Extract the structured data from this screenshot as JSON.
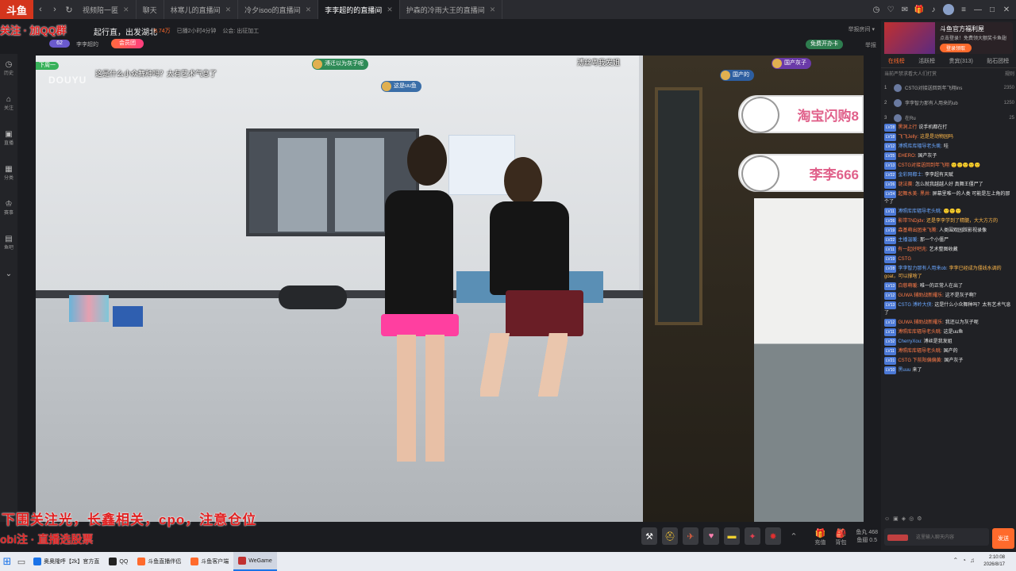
{
  "tabs": [
    {
      "label": "视频陪一匿",
      "active": false
    },
    {
      "label": "聊天",
      "active": false
    },
    {
      "label": "林寒儿的直播间",
      "active": false
    },
    {
      "label": "冷夕isoo的直播间",
      "active": false
    },
    {
      "label": "李李超的的直播间",
      "active": true
    },
    {
      "label": "护森的冷雨大王的直播间",
      "active": false
    }
  ],
  "app_logo": "斗鱼",
  "room": {
    "title": "起行直，出发湖北",
    "host_tag": "李李超的",
    "level": "62",
    "follow_label": "会员团",
    "meta": [
      "5.74万",
      "已播2小时4分钟",
      "公会: 出征加工"
    ],
    "share": "举报房间 ▾",
    "free_pill": "免费开办卡",
    "report": "举报"
  },
  "left_rail": [
    "历史",
    "关注",
    "直播",
    "分类",
    "赛事",
    "鱼吧"
  ],
  "overlay": {
    "top_text": "关注 · 加QQ群",
    "bottom_text": "下围关注光，长鑫相关，cpo，注意仓位",
    "bottom_text2": "obi注 · 直播选股票"
  },
  "video": {
    "watermark": "DOUYU",
    "progress_badge": "下周一",
    "danmu": [
      {
        "text": "这是什么小众舞种吗？太有艺术气息了",
        "color": "#ffffff"
      },
      {
        "text": "溥丝粤我发姐",
        "color": "#ffffff"
      }
    ],
    "badges": [
      {
        "text": "溥迁以为灰子呢",
        "color": "#2e8b57"
      },
      {
        "text": "这是uu鱼",
        "color": "#3a6ea8"
      },
      {
        "text": "国产的",
        "color": "#2d5ea0"
      },
      {
        "text": "国产灰子",
        "color": "#6a3aa8"
      }
    ],
    "stickers": [
      {
        "text": "淘宝闪购8"
      },
      {
        "text": "李李666"
      }
    ]
  },
  "gift_icons": [
    "hammer-icon",
    "helmet-icon",
    "rocket-icon",
    "heart-icon",
    "gold-bar-icon",
    "plane-icon",
    "fire-icon"
  ],
  "gift_right": [
    {
      "label": "充值",
      "icon": "🎁"
    },
    {
      "label": "背包",
      "icon": "🎒"
    },
    {
      "label": "鱼丸 468",
      "icon": ""
    },
    {
      "label": "鱼翅 0.5",
      "icon": ""
    }
  ],
  "side": {
    "promo": {
      "t1": "斗鱼官方福利屋",
      "t2": "点击登录！免费领大额奖卡鱼翅",
      "btn": "登录领取"
    },
    "tabs": [
      "在线榜",
      "活跃榜",
      "贵宾(313)",
      "贴石团榜"
    ],
    "rank_header": [
      "当前严禁求看大人们打赏",
      "规则"
    ],
    "rank": [
      {
        "n": "1",
        "name": "CSTG对接送回到年飞翔ins",
        "score": "2350"
      },
      {
        "n": "2",
        "name": "李李智力那有人用来的ub",
        "score": "1250"
      },
      {
        "n": "3",
        "name": "在Ru",
        "score": "25"
      }
    ],
    "chat": [
      {
        "lv": "LV28",
        "user": "黑洞上行",
        "text": "说手机都在打"
      },
      {
        "lv": "LV18",
        "user": "飞飞Jelly:",
        "text": "这是是动物园吗",
        "orange": true
      },
      {
        "lv": "LV12",
        "user": "溥照库库辐导老头眺:",
        "text": "哇"
      },
      {
        "lv": "LV25",
        "user": "EHERO:",
        "text": "国产灰子"
      },
      {
        "lv": "LV13",
        "user": "CSTG对接送回到年飞翔",
        "text": "🙂🙂🙂🙂🙂"
      },
      {
        "lv": "LV22",
        "user": "金彩网都士:",
        "text": "李李超有天赋"
      },
      {
        "lv": "LV26",
        "user": "谜法赛:",
        "text": "怎么就我越越人好 真舞王僵尸了"
      },
      {
        "lv": "LV24",
        "user": "起舞水美· 黑井:",
        "text": "屏幕里唯一的人类 可能是左上角的那个了"
      },
      {
        "lv": "LV11",
        "user": "溥照库库辐导老头眺:",
        "text": "🙂🙂🙂"
      },
      {
        "lv": "LV26",
        "user": "影带TNDjdv:",
        "text": "还是李李学到了精髓，大大方方的",
        "orange": true
      },
      {
        "lv": "LV19",
        "user": "森基萌出团来飞腾:",
        "text": "人类围观园踩影视录像"
      },
      {
        "lv": "LV22",
        "user": "主播温暖:",
        "text": "那一个小僵尸"
      },
      {
        "lv": "LV11",
        "user": "有一起好吧兆:",
        "text": "艺术整图收藏"
      },
      {
        "lv": "LV19",
        "user": "CSTG",
        "text": ""
      },
      {
        "lv": "LV28",
        "user": "李李智力那有人用来ob:",
        "text": "李李已经成为僵线水调的goat，可以撑啥了",
        "orange": true
      },
      {
        "lv": "LV13",
        "user": "白慈萌暖:",
        "text": "唯一的正常人在出了"
      },
      {
        "lv": "LV12",
        "user": "GUWA 辅助战新耀乐:",
        "text": "这不是灰子啊？"
      },
      {
        "lv": "LV13",
        "user": "CSTG 溥岭大侠:",
        "text": "这是什么小众舞种吗？太有艺术气息了"
      },
      {
        "lv": "LV12",
        "user": "GUWA 辅助战新耀乐:",
        "text": "我还以为灰子呢"
      },
      {
        "lv": "LV11",
        "user": "溥照库库辐导老头眺:",
        "text": "这是uu鱼"
      },
      {
        "lv": "LV32",
        "user": "CherryXou:",
        "text": "溥丝是我发姐"
      },
      {
        "lv": "LV11",
        "user": "溥照库库辐导老头眺:",
        "text": "国产的"
      },
      {
        "lv": "LV21",
        "user": "CSTG 下前阳偏偏黄:",
        "text": "国产灰子"
      },
      {
        "lv": "LV10",
        "user": "黑uuu",
        "text": "来了"
      }
    ],
    "input_placeholder": "这里输入聊天内容",
    "send_label": "发送"
  },
  "taskbar": {
    "items": [
      {
        "label": "奥奥隆呼【2k】官方直",
        "color": "#1a73e8"
      },
      {
        "label": "QQ",
        "color": "#222"
      },
      {
        "label": "斗鱼直播伴侣",
        "color": "#ff6a2c"
      },
      {
        "label": "斗鱼客户端",
        "color": "#ff6a2c"
      },
      {
        "label": "WeGame",
        "color": "#c03030",
        "active": true
      }
    ],
    "time": "2:10:08",
    "date": "2026/8/17"
  }
}
